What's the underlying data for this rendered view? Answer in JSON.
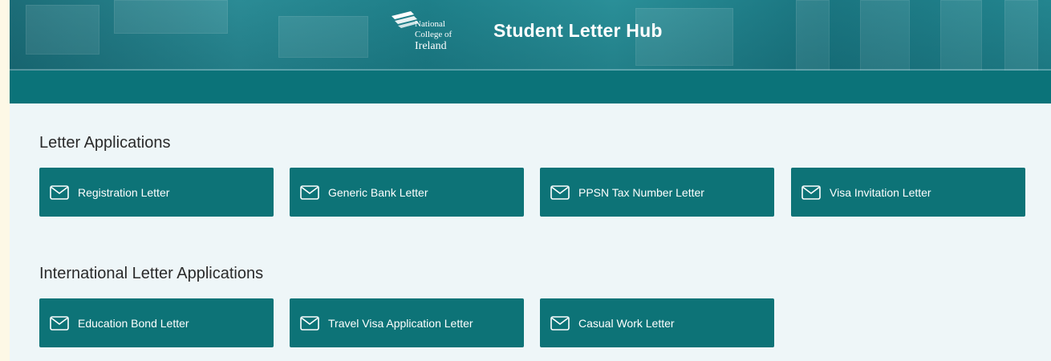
{
  "header": {
    "logo": {
      "line1": "National",
      "line2": "College of",
      "line3": "Ireland",
      "icon": "nci-logo-icon"
    },
    "title": "Student Letter Hub"
  },
  "sections": [
    {
      "title": "Letter Applications",
      "items": [
        {
          "label": "Registration Letter",
          "icon": "envelope-icon"
        },
        {
          "label": "Generic Bank Letter",
          "icon": "envelope-icon"
        },
        {
          "label": "PPSN Tax Number Letter",
          "icon": "envelope-icon"
        },
        {
          "label": "Visa Invitation Letter",
          "icon": "envelope-icon"
        }
      ]
    },
    {
      "title": "International Letter Applications",
      "items": [
        {
          "label": "Education Bond Letter",
          "icon": "envelope-icon"
        },
        {
          "label": "Travel Visa Application Letter",
          "icon": "envelope-icon"
        },
        {
          "label": "Casual Work Letter",
          "icon": "envelope-icon"
        }
      ]
    }
  ],
  "colors": {
    "brand": "#0d7377",
    "band": "#0b7379",
    "background": "#eef6f8"
  }
}
